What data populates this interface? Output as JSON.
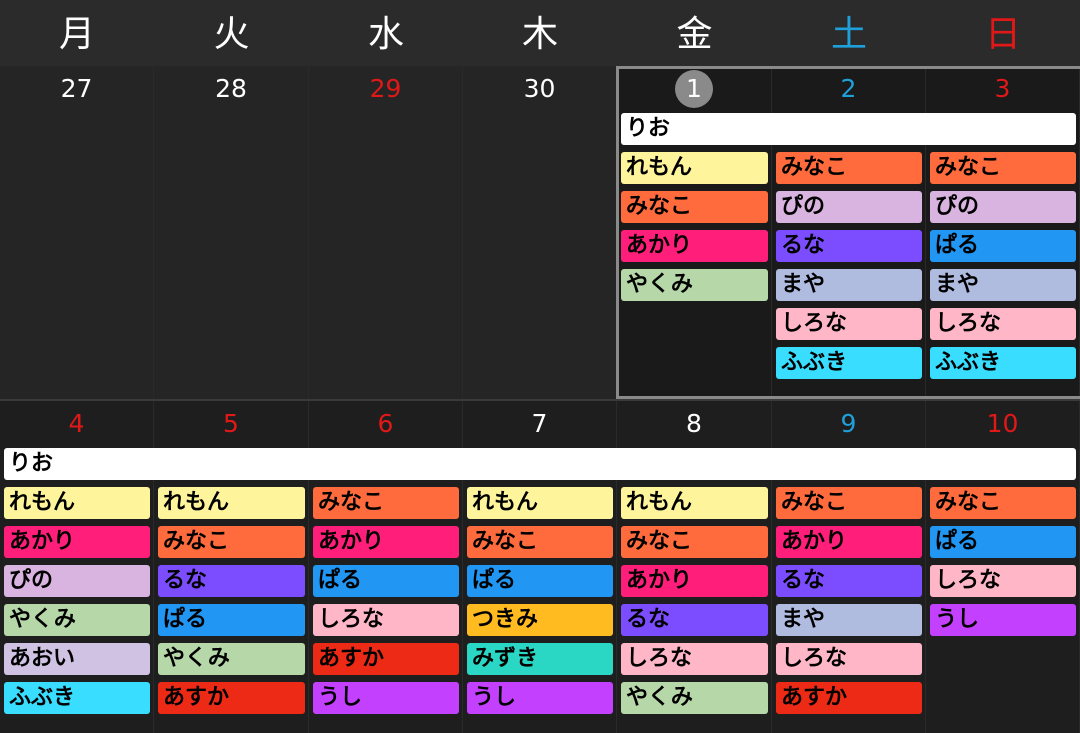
{
  "weekdays": [
    {
      "label": "月",
      "kind": "weekday"
    },
    {
      "label": "火",
      "kind": "weekday"
    },
    {
      "label": "水",
      "kind": "weekday"
    },
    {
      "label": "木",
      "kind": "weekday"
    },
    {
      "label": "金",
      "kind": "weekday"
    },
    {
      "label": "土",
      "kind": "sat"
    },
    {
      "label": "日",
      "kind": "sun"
    }
  ],
  "colors": {
    "white": "#ffffff",
    "yellow": "#fef49c",
    "orange": "#ff6b3d",
    "pink": "#ff1f7a",
    "sage": "#b6d7a8",
    "lavender": "#dab4e0",
    "purple": "#7c4dff",
    "blue": "#2196f3",
    "slate": "#b0bbe0",
    "lightpink": "#ffb7c7",
    "cyan": "#38ddff",
    "amber": "#ffbb1f",
    "red": "#ec2a16",
    "teal": "#2ad7c4",
    "violet": "#c440ff",
    "lilac": "#cfc2e3"
  },
  "weeks": [
    {
      "days": [
        {
          "date": "27",
          "kind": "weekday",
          "past": true
        },
        {
          "date": "28",
          "kind": "weekday",
          "past": true
        },
        {
          "date": "29",
          "kind": "hol",
          "past": true
        },
        {
          "date": "30",
          "kind": "weekday",
          "past": true
        },
        {
          "date": "1",
          "kind": "weekday",
          "today": true
        },
        {
          "date": "2",
          "kind": "sat"
        },
        {
          "date": "3",
          "kind": "sun"
        }
      ],
      "spans": [
        {
          "label": "りお",
          "start": 4,
          "end": 6,
          "color": "white"
        }
      ],
      "events": [
        [],
        [],
        [],
        [],
        [
          {
            "label": "れもん",
            "color": "yellow"
          },
          {
            "label": "みなこ",
            "color": "orange"
          },
          {
            "label": "あかり",
            "color": "pink"
          },
          {
            "label": "やくみ",
            "color": "sage"
          }
        ],
        [
          {
            "label": "みなこ",
            "color": "orange"
          },
          {
            "label": "ぴの",
            "color": "lavender"
          },
          {
            "label": "るな",
            "color": "purple"
          },
          {
            "label": "まや",
            "color": "slate"
          },
          {
            "label": "しろな",
            "color": "lightpink"
          },
          {
            "label": "ふぶき",
            "color": "cyan"
          }
        ],
        [
          {
            "label": "みなこ",
            "color": "orange"
          },
          {
            "label": "ぴの",
            "color": "lavender"
          },
          {
            "label": "ぱる",
            "color": "blue"
          },
          {
            "label": "まや",
            "color": "slate"
          },
          {
            "label": "しろな",
            "color": "lightpink"
          },
          {
            "label": "ふぶき",
            "color": "cyan"
          }
        ]
      ]
    },
    {
      "days": [
        {
          "date": "4",
          "kind": "hol"
        },
        {
          "date": "5",
          "kind": "hol"
        },
        {
          "date": "6",
          "kind": "hol"
        },
        {
          "date": "7",
          "kind": "weekday"
        },
        {
          "date": "8",
          "kind": "weekday"
        },
        {
          "date": "9",
          "kind": "sat"
        },
        {
          "date": "10",
          "kind": "sun"
        }
      ],
      "spans": [
        {
          "label": "りお",
          "start": 0,
          "end": 6,
          "color": "white"
        }
      ],
      "events": [
        [
          {
            "label": "れもん",
            "color": "yellow"
          },
          {
            "label": "あかり",
            "color": "pink"
          },
          {
            "label": "ぴの",
            "color": "lavender"
          },
          {
            "label": "やくみ",
            "color": "sage"
          },
          {
            "label": "あおい",
            "color": "lilac"
          },
          {
            "label": "ふぶき",
            "color": "cyan"
          }
        ],
        [
          {
            "label": "れもん",
            "color": "yellow"
          },
          {
            "label": "みなこ",
            "color": "orange"
          },
          {
            "label": "るな",
            "color": "purple"
          },
          {
            "label": "ぱる",
            "color": "blue"
          },
          {
            "label": "やくみ",
            "color": "sage"
          },
          {
            "label": "あすか",
            "color": "red"
          }
        ],
        [
          {
            "label": "みなこ",
            "color": "orange"
          },
          {
            "label": "あかり",
            "color": "pink"
          },
          {
            "label": "ぱる",
            "color": "blue"
          },
          {
            "label": "しろな",
            "color": "lightpink"
          },
          {
            "label": "あすか",
            "color": "red"
          },
          {
            "label": "うし",
            "color": "violet"
          }
        ],
        [
          {
            "label": "れもん",
            "color": "yellow"
          },
          {
            "label": "みなこ",
            "color": "orange"
          },
          {
            "label": "ぱる",
            "color": "blue"
          },
          {
            "label": "つきみ",
            "color": "amber"
          },
          {
            "label": "みずき",
            "color": "teal"
          },
          {
            "label": "うし",
            "color": "violet"
          }
        ],
        [
          {
            "label": "れもん",
            "color": "yellow"
          },
          {
            "label": "みなこ",
            "color": "orange"
          },
          {
            "label": "あかり",
            "color": "pink"
          },
          {
            "label": "るな",
            "color": "purple"
          },
          {
            "label": "しろな",
            "color": "lightpink"
          },
          {
            "label": "やくみ",
            "color": "sage"
          }
        ],
        [
          {
            "label": "みなこ",
            "color": "orange"
          },
          {
            "label": "あかり",
            "color": "pink"
          },
          {
            "label": "るな",
            "color": "purple"
          },
          {
            "label": "まや",
            "color": "slate"
          },
          {
            "label": "しろな",
            "color": "lightpink"
          },
          {
            "label": "あすか",
            "color": "red"
          }
        ],
        [
          {
            "label": "みなこ",
            "color": "orange"
          },
          {
            "label": "ぱる",
            "color": "blue"
          },
          {
            "label": "しろな",
            "color": "lightpink"
          },
          {
            "label": "うし",
            "color": "violet"
          }
        ]
      ]
    }
  ]
}
